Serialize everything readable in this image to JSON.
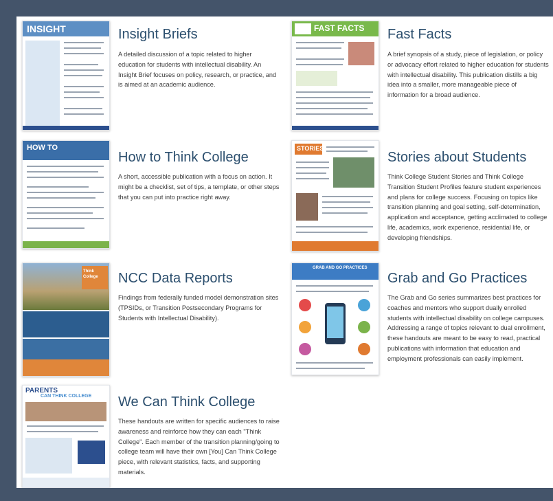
{
  "publications": [
    {
      "title": "Insight Briefs",
      "description": "A detailed discussion of a topic related to higher education for students with intellectual disability. An Insight Brief focuses on policy, research, or practice, and is aimed at an academic audience.",
      "thumbnail_text": "INSIGHT"
    },
    {
      "title": "Fast Facts",
      "description": "A brief synopsis of a study, piece of legislation, or policy or advocacy effort related to higher education for students with intellectual disability. This publication distills a big idea into a smaller, more manageable piece of information for a broad audience.",
      "thumbnail_text": "FAST FACTS"
    },
    {
      "title": "How to Think College",
      "description": "A short, accessible publication with a focus on action. It might be a checklist, set of tips, a template, or other steps that you can put into practice right away.",
      "thumbnail_text": "HOW TO"
    },
    {
      "title": "Stories about Students",
      "description": "Think College Student Stories and Think College Transition Student Profiles feature student experiences and plans for college success. Focusing on topics like transition planning and goal setting, self-determination, application and acceptance, getting acclimated to college life, academics, work experience, residential life, or developing friendships.",
      "thumbnail_text": "STORIES"
    },
    {
      "title": "NCC Data Reports",
      "description": "Findings from federally funded model demonstration sites (TPSIDs, or Transition Postsecondary Programs for Students with Intellectual Disability).",
      "thumbnail_text": "Think College"
    },
    {
      "title": "Grab and Go Practices",
      "description": "The Grab and Go series summarizes best practices for coaches and mentors who support dually enrolled students with intellectual disability on college campuses. Addressing a range of topics relevant to dual enrollment, these handouts are meant to be easy to read, practical publications with information that education and employment professionals can easily implement.",
      "thumbnail_text": "GRAB AND GO PRACTICES"
    },
    {
      "title": "We Can Think College",
      "description": "These handouts are written for specific audiences to raise awareness and reinforce how they can each \"Think College\". Each member of the transition planning/going to college team will have their own [You] Can Think College piece, with relevant statistics, facts, and supporting materials.",
      "thumbnail_text": "PARENTS",
      "thumbnail_subtext": "CAN THINK COLLEGE"
    }
  ]
}
